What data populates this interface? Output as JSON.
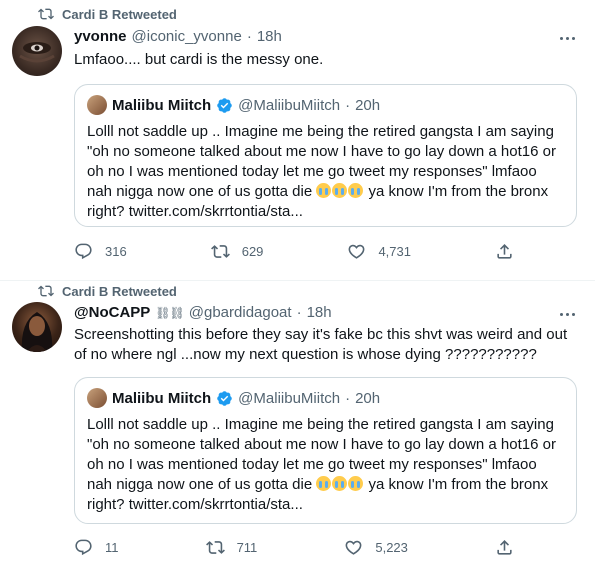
{
  "tweets": [
    {
      "retweeted_by": "Cardi B Retweeted",
      "author": {
        "name": "yvonne",
        "handle": "@iconic_yvonne",
        "time": "18h"
      },
      "text": "Lmfaoo.... but cardi is the messy one.",
      "quote": {
        "name": "Maliibu Miitch",
        "handle": "@MaliibuMiitch",
        "time": "20h",
        "text_before": "Lolll not saddle up .. Imagine me being the retired gangsta I am saying \"oh no someone talked about me now I have to go lay down a hot16 or oh no I was mentioned today let me go tweet my responses\" lmfaoo nah nigga now one of us gotta die ",
        "emojis": [
          "loudly-crying-face",
          "loudly-crying-face",
          "loudly-crying-face"
        ],
        "text_after": " ya know I'm from the bronx right? twitter.com/skrrtontia/sta..."
      },
      "actions": {
        "replies": "316",
        "retweets": "629",
        "likes": "4,731"
      }
    },
    {
      "retweeted_by": "Cardi B Retweeted",
      "author": {
        "name": "@NoCAPP",
        "name_emoji": "⛓⛓",
        "handle": "@gbardidagoat",
        "time": "18h"
      },
      "text": "Screenshotting this before they say it's fake bc this shvt was weird and out of no where ngl ...now my next question is whose dying ???????????",
      "quote": {
        "name": "Maliibu Miitch",
        "handle": "@MaliibuMiitch",
        "time": "20h",
        "text_before": "Lolll not saddle up .. Imagine me being the retired gangsta I am saying \"oh no someone talked about me now I have to go lay down a hot16 or oh no I was mentioned today let me go tweet my responses\" lmfaoo nah nigga now one of us gotta die ",
        "emojis": [
          "loudly-crying-face",
          "loudly-crying-face",
          "loudly-crying-face"
        ],
        "text_after": " ya know I'm from the bronx right? twitter.com/skrrtontia/sta..."
      },
      "actions": {
        "replies": "11",
        "retweets": "711",
        "likes": "5,223"
      }
    }
  ],
  "colors": {
    "text": "#0f1419",
    "muted": "#536471",
    "border": "#cfd9de",
    "verified": "#1d9bf0"
  },
  "separator": "·"
}
